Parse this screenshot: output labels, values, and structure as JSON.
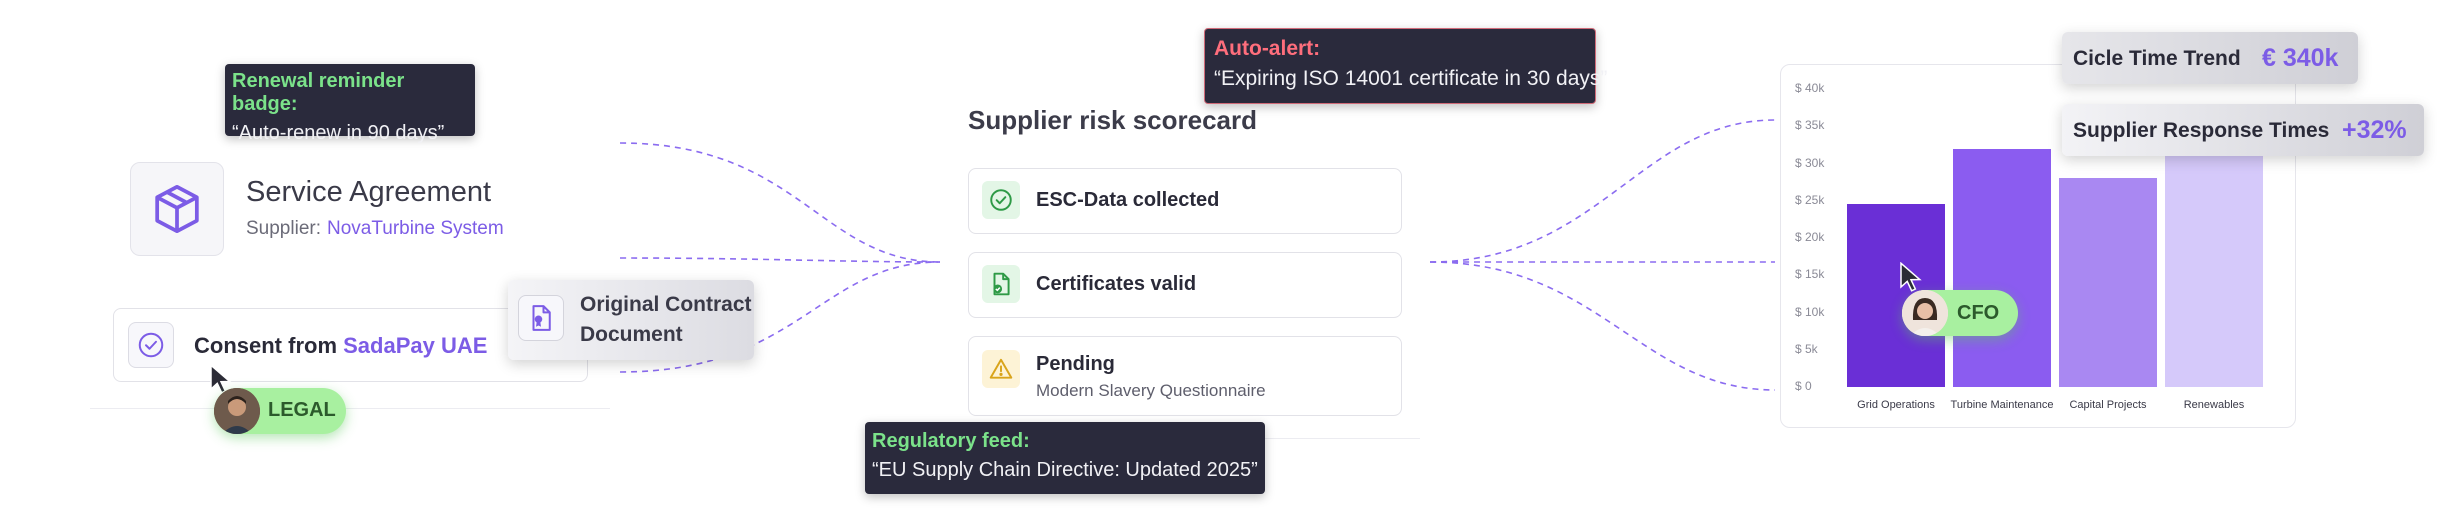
{
  "service": {
    "title": "Service Agreement",
    "supplier_label": "Supplier:",
    "supplier_name": "NovaTurbine System",
    "icon": "box-icon"
  },
  "consent": {
    "prefix": "Consent from",
    "org": "SadaPay UAE",
    "icon": "check-circle-icon"
  },
  "document": {
    "title_line1": "Original Contract",
    "title_line2": "Document",
    "icon": "contract-document-icon"
  },
  "renewal_badge": {
    "heading": "Renewal reminder badge:",
    "text": "“Auto-renew in 90 days”"
  },
  "legal_pill": {
    "label": "LEGAL"
  },
  "scorecard": {
    "title": "Supplier risk scorecard",
    "items": [
      {
        "label": "ESC-Data collected",
        "sub": "",
        "icon": "check-circle-icon",
        "status_color": "#2e9a46"
      },
      {
        "label": "Certificates valid",
        "sub": "",
        "icon": "certificate-file-icon",
        "status_color": "#2e9a46"
      },
      {
        "label": "Pending",
        "sub": "Modern Slavery Questionnaire",
        "icon": "warning-triangle-icon",
        "status_color": "#d9a41b"
      }
    ]
  },
  "auto_alert": {
    "heading": "Auto-alert:",
    "text": "“Expiring ISO 14001 certificate in 30 days”"
  },
  "regulatory_feed": {
    "heading": "Regulatory feed:",
    "text": "“EU Supply Chain Directive: Updated 2025”"
  },
  "cfo_pill": {
    "label": "CFO"
  },
  "trend_card": {
    "label": "Cicle Time Trend",
    "value": "€ 340k"
  },
  "response_card": {
    "label": "Supplier Response Times",
    "value": "+32%"
  },
  "colors": {
    "accent": "#7c5ce6",
    "pill_green": "#a8f0a0",
    "tooltip_bg": "#2a2a3c",
    "connector": "#8b6cf0"
  },
  "chart_data": {
    "type": "bar",
    "categories": [
      "Grid Operations",
      "Turbine Maintenance",
      "Capital Projects",
      "Renewables"
    ],
    "values": [
      24500,
      32000,
      28000,
      38000
    ],
    "bar_colors": [
      "#6a2fd6",
      "#8b5cf0",
      "#a988f2",
      "#d5c9fa"
    ],
    "ylim": [
      0,
      40000
    ],
    "yticks": [
      "$ 0",
      "$ 5k",
      "$ 10k",
      "$ 15k",
      "$ 20k",
      "$ 25k",
      "$ 30k",
      "$ 35k",
      "$ 40k"
    ],
    "title": "",
    "xlabel": "",
    "ylabel": "",
    "grid": false
  }
}
